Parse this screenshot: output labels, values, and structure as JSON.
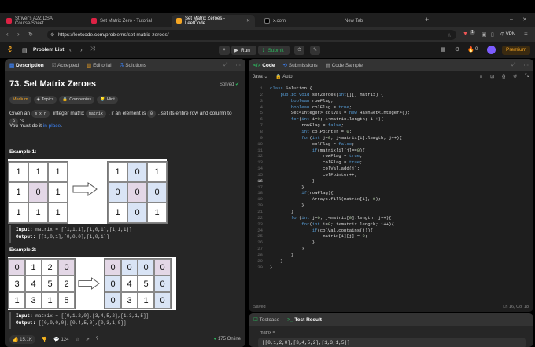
{
  "browser": {
    "tabs": [
      {
        "title": "Striver's A2Z DSA Course/Sheet",
        "color": "#d24"
      },
      {
        "title": "Set Matrix Zero - Tutorial",
        "color": "#d24"
      },
      {
        "title": "Set Matrix Zeroes - LeetCode",
        "color": "#f5a623"
      },
      {
        "title": "x.com",
        "color": "#222"
      },
      {
        "title": "New Tab",
        "color": "#444"
      }
    ],
    "url": "https://leetcode.com/problems/set-matrix-zeroes/",
    "vpn": "VPN",
    "ext_badge": "1"
  },
  "leetcode": {
    "problem_list": "Problem List",
    "run": "Run",
    "submit": "Submit",
    "coins": "0",
    "premium": "Premium"
  },
  "left": {
    "tabs": [
      "Description",
      "Accepted",
      "Editorial",
      "Solutions"
    ],
    "title": "73. Set Matrix Zeroes",
    "solved": "Solved",
    "chips": [
      "Medium",
      "Topics",
      "Companies",
      "Hint"
    ],
    "desc": {
      "p1a": "Given an ",
      "p1b": "m x n",
      "p1c": " integer matrix ",
      "p1d": "matrix",
      "p1e": ", if an element is ",
      "p1f": "0",
      "p1g": ", set its entire row and column to ",
      "p1h": "0",
      "p1i": "'s.",
      "p2a": "You must do it ",
      "p2b": "in place",
      "p2c": "."
    },
    "ex1": {
      "label": "Example 1:",
      "in": [
        [
          "1",
          "1",
          "1"
        ],
        [
          "1",
          "0",
          "1"
        ],
        [
          "1",
          "1",
          "1"
        ]
      ],
      "out": [
        [
          "1",
          "0",
          "1"
        ],
        [
          "0",
          "0",
          "0"
        ],
        [
          "1",
          "0",
          "1"
        ]
      ],
      "input_label": "Input:",
      "input": " matrix = [[1,1,1],[1,0,1],[1,1,1]]",
      "output_label": "Output:",
      "output": " [[1,0,1],[0,0,0],[1,0,1]]"
    },
    "ex2": {
      "label": "Example 2:",
      "in": [
        [
          "0",
          "1",
          "2",
          "0"
        ],
        [
          "3",
          "4",
          "5",
          "2"
        ],
        [
          "1",
          "3",
          "1",
          "5"
        ]
      ],
      "out": [
        [
          "0",
          "0",
          "0",
          "0"
        ],
        [
          "0",
          "4",
          "5",
          "0"
        ],
        [
          "0",
          "3",
          "1",
          "0"
        ]
      ],
      "input_label": "Input:",
      "input": " matrix = [[0,1,2,0],[3,4,5,2],[1,3,1,5]]",
      "output_label": "Output:",
      "output": " [[0,0,0,0],[0,4,5,0],[0,3,1,0]]"
    },
    "footer": {
      "likes": "15.1K",
      "comments": "124",
      "online": "175 Online"
    }
  },
  "right": {
    "tabs": [
      "Code",
      "Submissions",
      "Code Sample"
    ],
    "lang": "Java",
    "auto": "Auto",
    "code": [
      "class Solution {",
      "    public void setZeroes(int[][] matrix) {",
      "        boolean rowFlag;",
      "        boolean colFlag = true;",
      "        Set<Integer> colVal = new HashSet<Integer>();",
      "        for(int i=0; i<matrix.length; i++){",
      "            rowFlag = false;",
      "            int colPointer = 0;",
      "            for(int j=0; j<matrix[i].length; j++){",
      "                colFlag = false;",
      "                if(matrix[i][j]==0){",
      "                    rowFlag = true;",
      "                    colFlag = true;",
      "                    colVal.add(j);",
      "                    colPointer++;",
      "                }",
      "            }",
      "            if(rowFlag){",
      "                Arrays.fill(matrix[i], 0);",
      "            }",
      "        }",
      "        for(int j=0; j<matrix[0].length; j++){",
      "            for(int i=0; i<matrix.length; i++){",
      "                if(colVal.contains(j)){",
      "                    matrix[i][j] = 0;",
      "                }",
      "            }",
      "        }",
      "    }",
      "}"
    ],
    "current_line": 16,
    "saved": "Saved",
    "position": "Ln 16, Col 18"
  },
  "bottom": {
    "tabs": [
      "Testcase",
      "Test Result"
    ],
    "var": "matrix =",
    "value": "[[0,1,2,0],[3,4,5,2],[1,3,1,5]]"
  }
}
